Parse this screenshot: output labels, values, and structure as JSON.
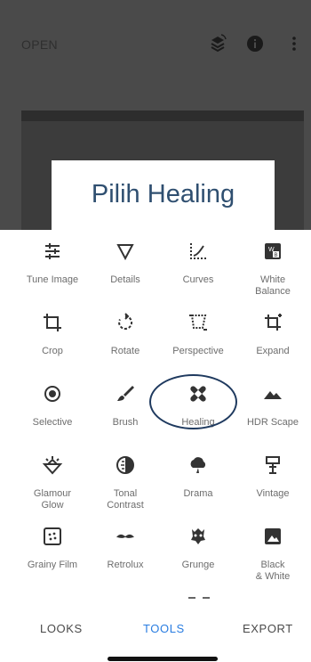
{
  "header": {
    "open_label": "OPEN"
  },
  "overlay": {
    "caption": "Pilih Healing"
  },
  "tools": [
    {
      "label": "Tune Image",
      "icon": "tune-image-icon"
    },
    {
      "label": "Details",
      "icon": "details-icon"
    },
    {
      "label": "Curves",
      "icon": "curves-icon"
    },
    {
      "label": "White\nBalance",
      "icon": "white-balance-icon"
    },
    {
      "label": "Crop",
      "icon": "crop-icon"
    },
    {
      "label": "Rotate",
      "icon": "rotate-icon"
    },
    {
      "label": "Perspective",
      "icon": "perspective-icon"
    },
    {
      "label": "Expand",
      "icon": "expand-icon"
    },
    {
      "label": "Selective",
      "icon": "selective-icon"
    },
    {
      "label": "Brush",
      "icon": "brush-icon"
    },
    {
      "label": "Healing",
      "icon": "healing-icon"
    },
    {
      "label": "HDR Scape",
      "icon": "hdr-scape-icon"
    },
    {
      "label": "Glamour\nGlow",
      "icon": "glamour-glow-icon"
    },
    {
      "label": "Tonal\nContrast",
      "icon": "tonal-contrast-icon"
    },
    {
      "label": "Drama",
      "icon": "drama-icon"
    },
    {
      "label": "Vintage",
      "icon": "vintage-icon"
    },
    {
      "label": "Grainy Film",
      "icon": "grainy-film-icon"
    },
    {
      "label": "Retrolux",
      "icon": "retrolux-icon"
    },
    {
      "label": "Grunge",
      "icon": "grunge-icon"
    },
    {
      "label": "Black\n& White",
      "icon": "black-white-icon"
    }
  ],
  "nav": {
    "looks_label": "LOOKS",
    "tools_label": "TOOLS",
    "export_label": "EXPORT",
    "active_tab": "TOOLS"
  },
  "colors": {
    "active_tab": "#2a7de1",
    "inactive_tab": "#4a4a4a",
    "overlay_text": "#2f4f70",
    "highlight_ellipse": "#1f3a5f"
  }
}
